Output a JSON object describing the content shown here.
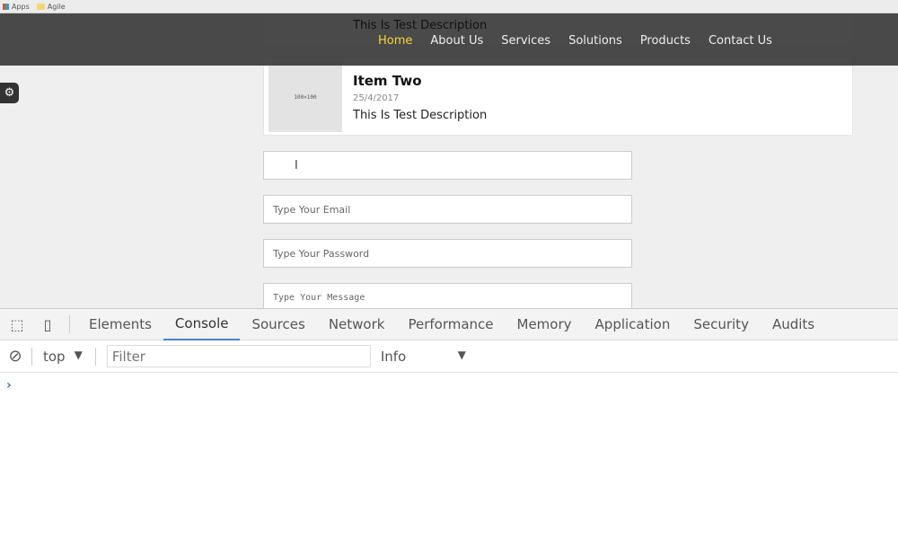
{
  "bookmarks": {
    "items": [
      {
        "label": "Apps"
      },
      {
        "label": "Agile"
      }
    ]
  },
  "nav": {
    "items": [
      "Home",
      "About Us",
      "Services",
      "Solutions",
      "Products",
      "Contact Us"
    ],
    "active": "Home",
    "active_color": "#f5d33a"
  },
  "cards": [
    {
      "description": "This Is Test Description"
    },
    {
      "title": "Item Two",
      "date": "25/4/2017",
      "description": "This Is Test Description",
      "thumb": "100×100"
    }
  ],
  "form": {
    "email_placeholder": "Type Your Email",
    "password_placeholder": "Type Your Password",
    "message_placeholder": "Type Your Message",
    "cursor": "I"
  },
  "devtools": {
    "tabs": [
      "Elements",
      "Console",
      "Sources",
      "Network",
      "Performance",
      "Memory",
      "Application",
      "Security",
      "Audits"
    ],
    "active_tab": "Console",
    "context": "top",
    "filter_placeholder": "Filter",
    "level": "Info",
    "prompt": "›"
  }
}
